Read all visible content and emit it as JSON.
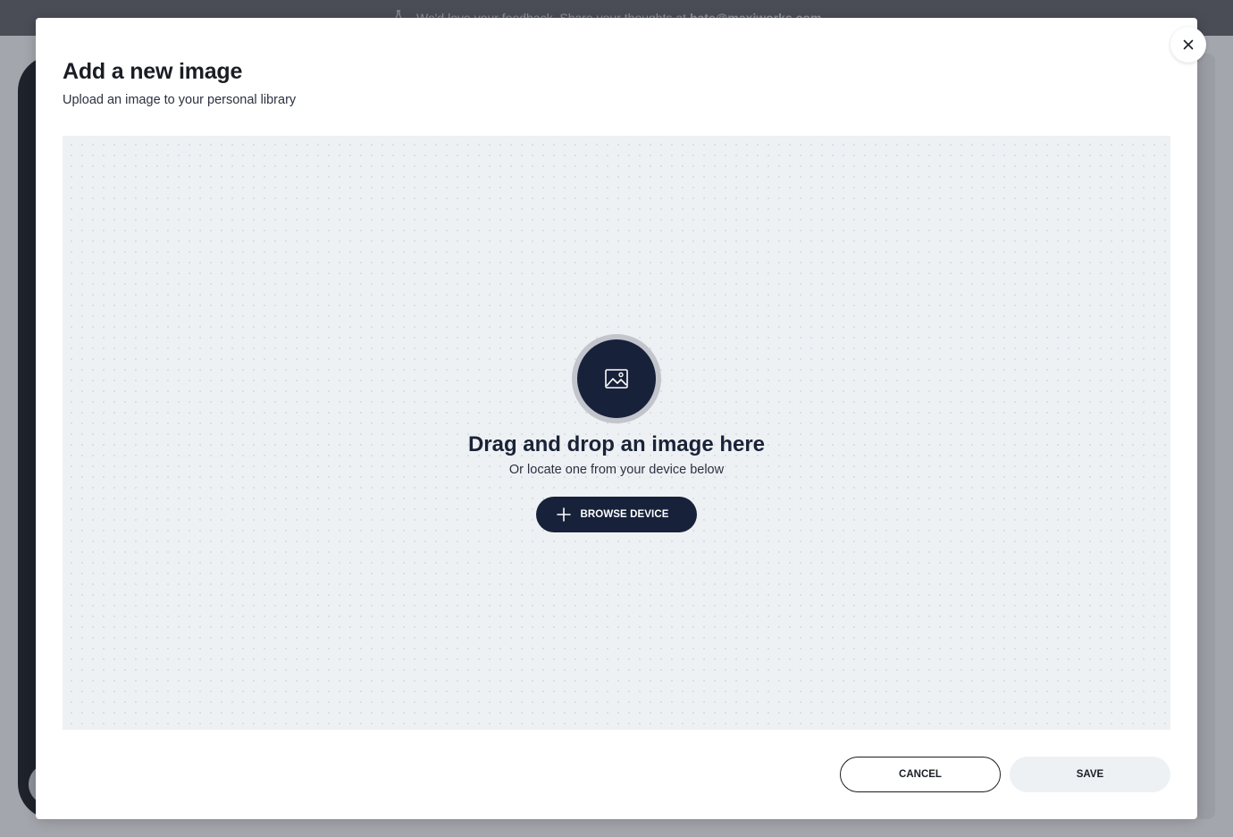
{
  "background": {
    "banner_prefix": "We'd love your feedback. Share your thoughts at ",
    "banner_email": "hate@maxiworks.com"
  },
  "modal": {
    "title": "Add a new image",
    "subtitle": "Upload an image to your personal library",
    "close_icon": "close-icon",
    "dropzone": {
      "icon": "image-icon",
      "heading": "Drag and drop an image here",
      "subtext": "Or locate one from your device below",
      "browse_icon": "plus-icon",
      "browse_label": "BROWSE DEVICE"
    },
    "footer": {
      "cancel_label": "CANCEL",
      "save_label": "SAVE"
    }
  },
  "colors": {
    "primary_dark": "#17213a",
    "dropzone_bg": "#eef1f4",
    "overlay": "#a3a6ac"
  }
}
